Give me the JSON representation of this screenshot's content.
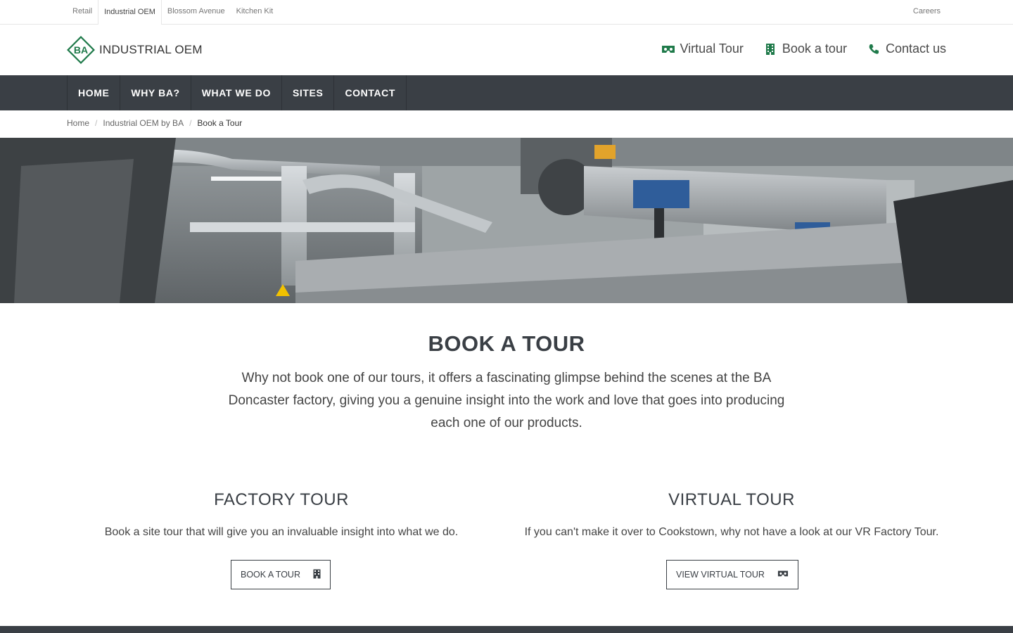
{
  "util": {
    "tabs": [
      "Retail",
      "Industrial OEM",
      "Blossom Avenue",
      "Kitchen Kit"
    ],
    "active_tab": "Industrial OEM",
    "right_link": "Careers"
  },
  "header": {
    "logo_badge": "BA",
    "logo_text": "INDUSTRIAL OEM",
    "links": {
      "virtual_tour": "Virtual Tour",
      "book_tour": "Book a tour",
      "contact": "Contact us"
    }
  },
  "nav": {
    "items": [
      "HOME",
      "WHY BA?",
      "WHAT WE DO",
      "SITES",
      "CONTACT"
    ]
  },
  "breadcrumb": {
    "home": "Home",
    "section": "Industrial OEM by BA",
    "current": "Book a Tour",
    "separator": "/"
  },
  "intro": {
    "title": "BOOK A TOUR",
    "text": "Why not book one of our tours, it offers a fascinating glimpse behind the scenes at the BA Doncaster factory, giving you a genuine insight into the work and love that goes into producing each one of our products."
  },
  "factory": {
    "title": "FACTORY TOUR",
    "text": "Book a site tour that will give you an invaluable insight into what we do.",
    "button": "BOOK A TOUR"
  },
  "virtual": {
    "title": "VIRTUAL TOUR",
    "text": "If you can't make it over to Cookstown, why not have a look at our VR Factory Tour.",
    "button": "VIEW VIRTUAL TOUR"
  },
  "colors": {
    "brand_green": "#1f7a4a",
    "nav_bg": "#3a3f45",
    "text_dark": "#3a3f45"
  },
  "icons": {
    "virtual_tour": "vr-headset-icon",
    "book_tour": "building-icon",
    "contact": "phone-icon"
  }
}
